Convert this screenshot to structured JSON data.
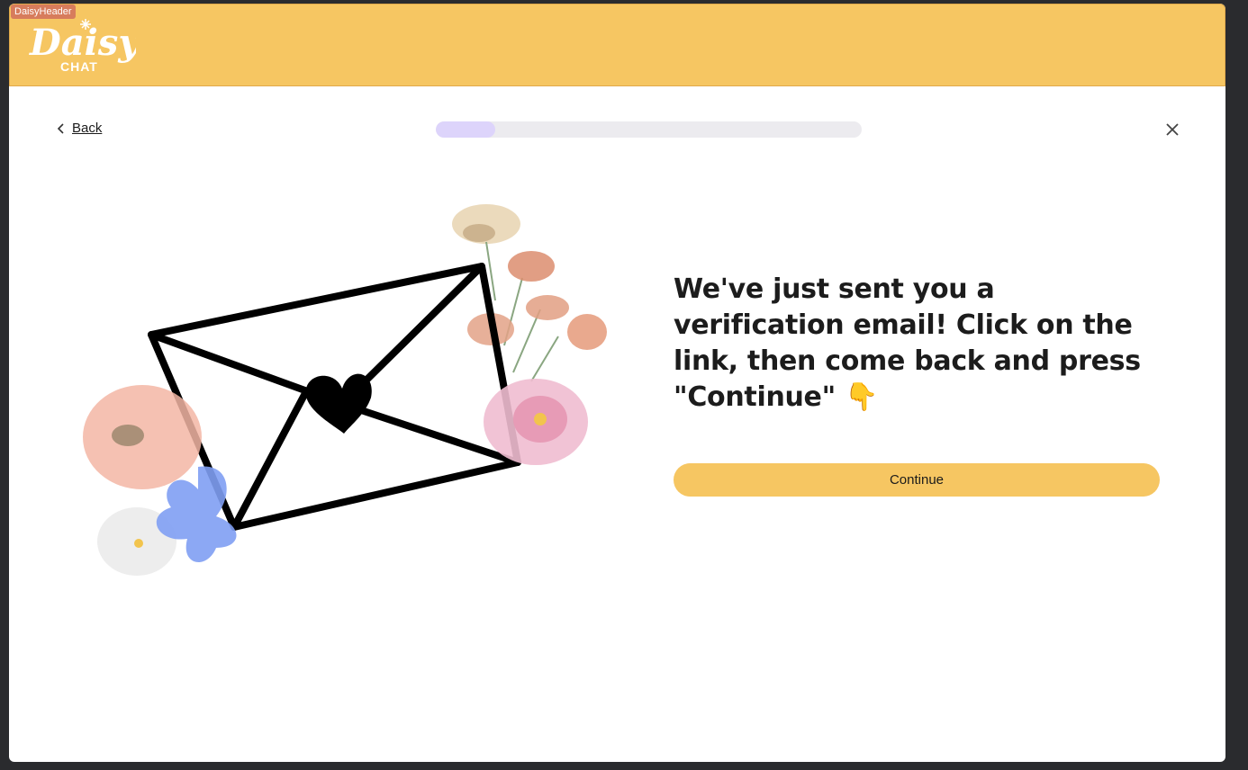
{
  "header": {
    "tag": "DaisyHeader",
    "logo_text": "Daisy",
    "logo_subtext": "CHAT",
    "background": "#f6c662"
  },
  "nav": {
    "back_label": "Back",
    "progress_percent": 14
  },
  "main": {
    "message": "We've just sent you a verification email! Click on the link, then come back and press \"Continue\" 👇",
    "continue_label": "Continue"
  },
  "colors": {
    "accent": "#f6c662",
    "progress_track": "#ecebef",
    "progress_fill": "#ddd4fb"
  }
}
